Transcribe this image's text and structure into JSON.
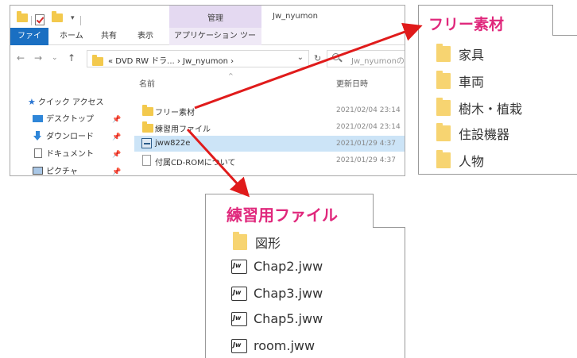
{
  "window": {
    "title": "Jw_nyumon",
    "context_tab": "管理"
  },
  "ribbon": {
    "tabs": [
      "ファイル",
      "ホーム",
      "共有",
      "表示",
      "アプリケーション ツール"
    ]
  },
  "address": {
    "path": "« DVD RW ドラ... › Jw_nyumon ›",
    "search_placeholder": "Jw_nyumonの"
  },
  "nav": {
    "quick_access": "クイック アクセス",
    "items": [
      "デスクトップ",
      "ダウンロード",
      "ドキュメント",
      "ピクチャ"
    ]
  },
  "columns": {
    "name": "名前",
    "date": "更新日時"
  },
  "files": [
    {
      "name": "フリー素材",
      "date": "2021/02/04 23:14",
      "type": "folder"
    },
    {
      "name": "練習用ファイル",
      "date": "2021/02/04 23:14",
      "type": "folder"
    },
    {
      "name": "jww822e",
      "date": "2021/01/29 4:37",
      "type": "app",
      "selected": true
    },
    {
      "name": "付属CD-ROMについて",
      "date": "2021/01/29 4:37",
      "type": "text"
    }
  ],
  "free_panel": {
    "title": "フリー素材",
    "items": [
      "家具",
      "車両",
      "樹木・植栽",
      "住設機器",
      "人物"
    ]
  },
  "practice_panel": {
    "title": "練習用ファイル",
    "items": [
      {
        "name": "図形",
        "type": "folder"
      },
      {
        "name": "Chap2.jww",
        "type": "jww"
      },
      {
        "name": "Chap3.jww",
        "type": "jww"
      },
      {
        "name": "Chap5.jww",
        "type": "jww"
      },
      {
        "name": "room.jww",
        "type": "jww"
      }
    ]
  },
  "jww_icon_label": "Jw",
  "colors": {
    "accent_title": "#e0287c",
    "arrow": "#e01b1b",
    "file_tab": "#1a6fc2",
    "selection": "#cce4f7",
    "folder": "#f3c94d"
  }
}
